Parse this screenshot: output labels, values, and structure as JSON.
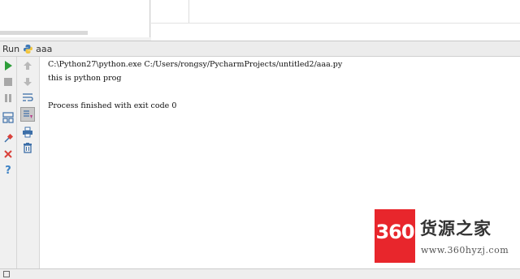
{
  "run_panel": {
    "title": "Run",
    "config_name": "aaa"
  },
  "toolbar_left": [
    {
      "name": "rerun-icon",
      "color": "#2e9e3a"
    },
    {
      "name": "stop-icon",
      "color": "#9a9a9a"
    },
    {
      "name": "pause-icon",
      "color": "#9a9a9a"
    },
    {
      "name": "restore-layout-icon",
      "color": "#3d6fa8"
    },
    {
      "name": "pin-icon",
      "color": "#3d6fa8"
    },
    {
      "name": "close-icon",
      "color": "#d9413b"
    },
    {
      "name": "help-icon",
      "color": "#3d82c4"
    }
  ],
  "toolbar_right": [
    {
      "name": "up-arrow-icon"
    },
    {
      "name": "down-arrow-icon"
    },
    {
      "name": "soft-wrap-icon"
    },
    {
      "name": "scroll-to-end-icon"
    },
    {
      "name": "print-icon"
    },
    {
      "name": "clear-all-icon"
    }
  ],
  "console": {
    "command": "C:\\Python27\\python.exe C:/Users/rongsy/PycharmProjects/untitled2/aaa.py",
    "output": "this is python prog",
    "exit_message": "Process finished with exit code 0"
  },
  "watermark": {
    "logo_text": "360",
    "brand": "货源之家",
    "url": "www.360hyzj.com",
    "logo_color": "#e8262c"
  }
}
